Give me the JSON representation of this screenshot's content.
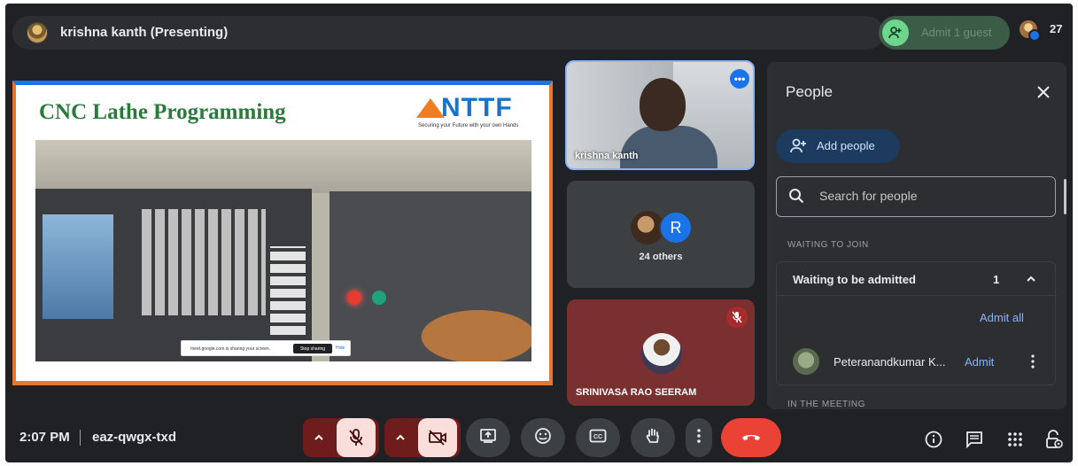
{
  "topbar": {
    "presenter_label": "krishna kanth (Presenting)",
    "admit_label": "Admit 1 guest",
    "participant_count": "27"
  },
  "slide": {
    "title": "CNC Lathe Programming",
    "logo_text": "NTTF",
    "logo_tagline": "Securing your Future with your own Hands",
    "share_notice": "meet.google.com is sharing your screen.",
    "stop_sharing_label": "Stop sharing",
    "hide_label": "Hide"
  },
  "tiles": {
    "self_name": "krishna kanth",
    "others_avatar_letter": "R",
    "others_label": "24 others",
    "srini_name": "SRINIVASA RAO SEERAM"
  },
  "people_panel": {
    "title": "People",
    "add_people_label": "Add people",
    "search_placeholder": "Search for people",
    "waiting_section": "WAITING TO JOIN",
    "waiting_title": "Waiting to be admitted",
    "waiting_count": "1",
    "admit_all_label": "Admit all",
    "guest_name": "Peteranandkumar K...",
    "guest_admit_label": "Admit",
    "meeting_section": "IN THE MEETING"
  },
  "bottombar": {
    "time": "2:07 PM",
    "meeting_code": "eaz-qwgx-txd"
  },
  "colors": {
    "background": "#202124",
    "accent": "#8ab4f8",
    "end_call": "#ea4335",
    "admit_green": "#6dd58c"
  },
  "icons": [
    "mic-off-icon",
    "camera-off-icon",
    "present-icon",
    "emoji-icon",
    "captions-icon",
    "raise-hand-icon",
    "more-options-icon",
    "end-call-icon",
    "info-icon",
    "chat-icon",
    "activities-icon",
    "host-controls-icon",
    "search-icon",
    "close-icon",
    "add-person-icon"
  ]
}
